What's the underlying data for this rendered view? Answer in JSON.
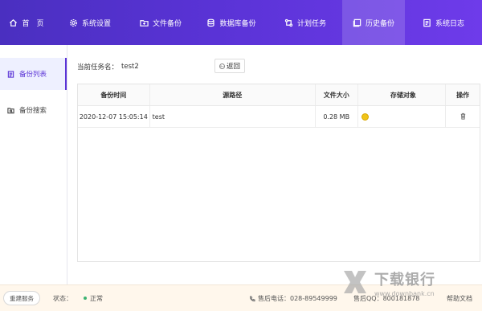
{
  "nav": {
    "items": [
      {
        "label": "首　页",
        "icon": "home-icon"
      },
      {
        "label": "系统设置",
        "icon": "gear-icon"
      },
      {
        "label": "文件备份",
        "icon": "folder-icon"
      },
      {
        "label": "数据库备份",
        "icon": "database-icon"
      },
      {
        "label": "计划任务",
        "icon": "schedule-icon"
      },
      {
        "label": "历史备份",
        "icon": "history-icon"
      },
      {
        "label": "系统日志",
        "icon": "log-icon"
      }
    ],
    "active_index": 5,
    "bg_color": "#5a33d6"
  },
  "sidebar": {
    "items": [
      {
        "label": "备份列表",
        "icon": "list-icon"
      },
      {
        "label": "备份搜索",
        "icon": "search-folder-icon"
      }
    ],
    "active_index": 0
  },
  "main": {
    "task_label": "当前任务名：",
    "task_name": "test2",
    "back_label": "返回",
    "table": {
      "headers": [
        "备份时间",
        "源路径",
        "文件大小",
        "存储对象",
        "操作"
      ],
      "rows": [
        {
          "time": "2020-12-07 15:05:14",
          "path": "test",
          "size": "0.28 MB",
          "storage_icon": "storage-object-icon",
          "action_icon": "trash-icon"
        }
      ]
    }
  },
  "footer": {
    "repair_label": "重建服务",
    "status_label": "状态：",
    "status_value": "正常",
    "status_color": "#3cb371",
    "phone_text": "售后电话：028-89549999",
    "phone2_text": "售后QQ：800181878",
    "help_text": "帮助文档"
  },
  "watermark": {
    "title": "下载银行",
    "site": "www.downbank.cn"
  }
}
